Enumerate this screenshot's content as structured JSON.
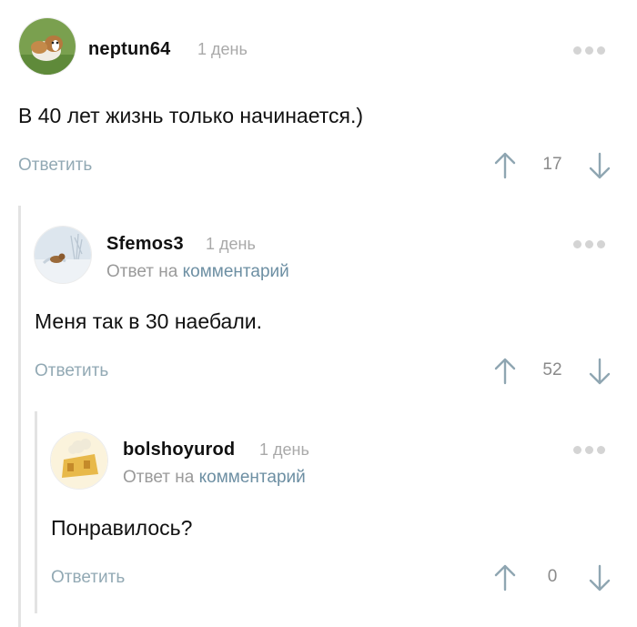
{
  "comments": [
    {
      "username": "neptun64",
      "time": "1 день",
      "text": "В 40 лет жизнь только начинается.)",
      "reply_label": "Ответить",
      "rating": "17"
    },
    {
      "username": "Sfemos3",
      "time": "1 день",
      "reply_to_prefix": "Ответ на",
      "reply_to_link": "комментарий",
      "text": "Меня так в 30 наебали.",
      "reply_label": "Ответить",
      "rating": "52"
    },
    {
      "username": "bolshoyurod",
      "time": "1 день",
      "reply_to_prefix": "Ответ на",
      "reply_to_link": "комментарий",
      "text": "Понравилось?",
      "reply_label": "Ответить",
      "rating": "0"
    }
  ],
  "colors": {
    "accent": "#6d8fa3",
    "reply_button": "#92a9b4",
    "muted": "#a9a9a9",
    "thread_line": "#e3e3e3"
  },
  "icons": {
    "more": "more-dots-icon",
    "upvote": "arrow-up-icon",
    "downvote": "arrow-down-icon"
  }
}
